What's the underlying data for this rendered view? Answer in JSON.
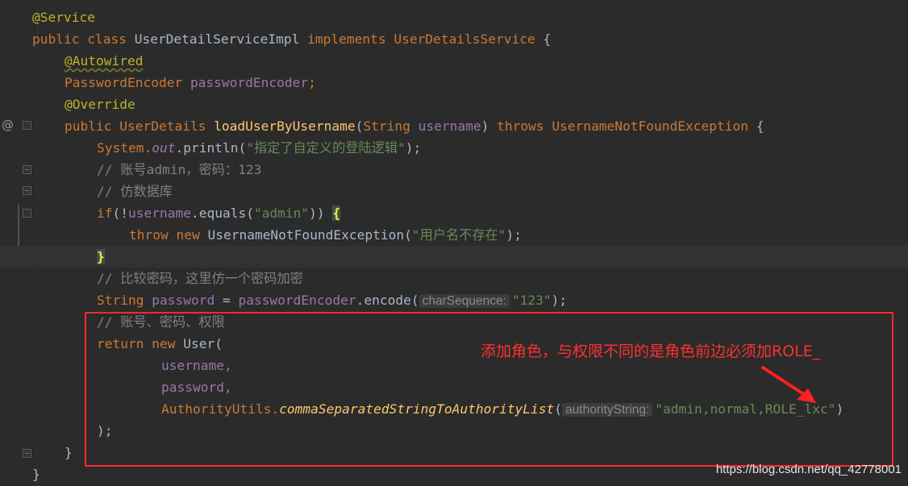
{
  "code": {
    "l1_ann": "@Service",
    "l2_kw1": "public class ",
    "l2_cls": "UserDetailServiceImpl",
    "l2_kw2": " implements ",
    "l2_iface": "UserDetailsService",
    "l2_brace": " {",
    "l3_ann": "@Autowired",
    "l4_type": "PasswordEncoder",
    "l4_field": "passwordEncoder",
    "l4_semi": ";",
    "l5_ann": "@Override",
    "l6_kw": "public ",
    "l6_type": "UserDetails",
    "l6_sp": " ",
    "l6_meth": "loadUserByUsername",
    "l6_open": "(",
    "l6_ptype": "String",
    "l6_pname": " username",
    "l6_close": ") ",
    "l6_throws": "throws ",
    "l6_exc": "UsernameNotFoundException",
    "l6_brace": " {",
    "l7_sys": "System.",
    "l7_out": "out",
    "l7_dot": ".println(",
    "l7_str": "\"指定了自定义的登陆逻辑\"",
    "l7_end": ");",
    "l8_cmt": "// 账号admin，密码：123",
    "l9_cmt": "// 仿数据库",
    "l10_if": "if",
    "l10_a": "(!",
    "l10_var": "username",
    "l10_b": ".equals(",
    "l10_str": "\"admin\"",
    "l10_c": ")) ",
    "l10_brace": "{",
    "l11_throw": "throw ",
    "l11_new": "new ",
    "l11_cls": "UsernameNotFoundException(",
    "l11_str": "\"用户名不存在\"",
    "l11_end": ");",
    "l12_brace": "}",
    "l13_cmt": "// 比较密码，这里仿一个密码加密",
    "l14_type": "String",
    "l14_var": " password",
    "l14_eq": " = ",
    "l14_fld": "passwordEncoder",
    "l14_call": ".encode(",
    "l14_hint": "charSequence:",
    "l14_str": "\"123\"",
    "l14_end": ");",
    "l15_cmt": "// 账号、密码、权限",
    "l16_ret": "return ",
    "l16_new": "new ",
    "l16_cls": "User(",
    "l17_arg": "username,",
    "l18_arg": "password,",
    "l19_cls": "AuthorityUtils.",
    "l19_meth": "commaSeparatedStringToAuthorityList",
    "l19_open": "(",
    "l19_hint": "authorityString:",
    "l19_str": "\"admin,normal,ROLE_lxc\"",
    "l19_end": ")",
    "l20": ");",
    "l21": "}",
    "l22": "}"
  },
  "annotation_note": "添加角色，与权限不同的是角色前边必须加ROLE_",
  "watermark": "https://blog.csdn.net/qq_42778001",
  "colors": {
    "background": "#2b2b2b",
    "keyword": "#cc7832",
    "string": "#6a8759",
    "comment": "#808080",
    "annotation": "#bbb529",
    "field": "#9876aa",
    "method": "#ffc66d",
    "highlight_box": "#ff2a2a"
  }
}
